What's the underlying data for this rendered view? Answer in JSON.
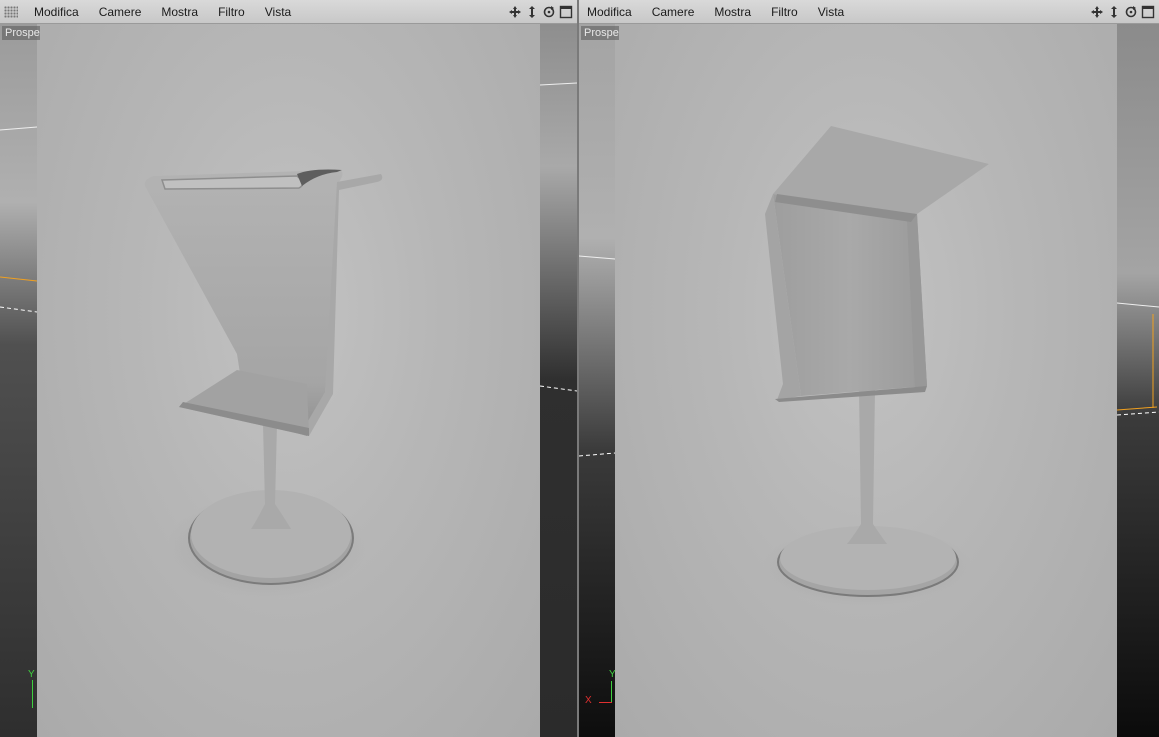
{
  "viewports": [
    {
      "id": "left",
      "menu": [
        "Modifica",
        "Camere",
        "Mostra",
        "Filtro",
        "Vista"
      ],
      "camera_label": "Prospettiva",
      "axis": {
        "y": "Y",
        "x": ""
      }
    },
    {
      "id": "right",
      "menu": [
        "Modifica",
        "Camere",
        "Mostra",
        "Filtro",
        "Vista"
      ],
      "camera_label": "Prospettiva",
      "axis": {
        "y": "Y",
        "x": "X"
      }
    }
  ],
  "toolbar_icons": [
    "move-icon",
    "dolly-icon",
    "rotate-icon",
    "maximize-icon"
  ],
  "colors": {
    "menubar": "#d0d0d0",
    "render_bg": "#b9b9b9",
    "axis_y": "#3fcf3f",
    "axis_x": "#e03030",
    "selection_orange": "#f0a020"
  }
}
